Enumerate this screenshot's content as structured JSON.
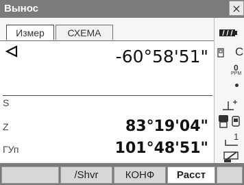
{
  "window": {
    "title": "Вынос",
    "close_glyph": "×"
  },
  "tabs": [
    {
      "label": "Измер",
      "active": true
    },
    {
      "label": "СХЕМА",
      "active": false
    }
  ],
  "measurements": {
    "angle_top_value": "-60°58'51\"",
    "rows": [
      {
        "label": "S",
        "value": ""
      },
      {
        "label": "Z",
        "value": "83°19'04\""
      },
      {
        "label": "ГУп",
        "value": "101°48'51\""
      }
    ]
  },
  "status_column": {
    "battery": "battery-icon",
    "sd_card": "sd-card-icon",
    "letter_c": "C",
    "ppm_value": "0",
    "ppm_label": "PPM",
    "prism": "prism-target-icon",
    "device": "instrument-icon",
    "face_indicator": "1",
    "input_mode": "pen-icon"
  },
  "softkeys": [
    {
      "label": ""
    },
    {
      "label": "/Shvr"
    },
    {
      "label": "КОНФ"
    },
    {
      "label": "Расст"
    },
    {
      "label": ""
    }
  ],
  "colors": {
    "titlebar_bg": "#7b7b7b",
    "softkey_bar_bg": "#7a7a7a",
    "panel_bg": "#ffffff"
  }
}
